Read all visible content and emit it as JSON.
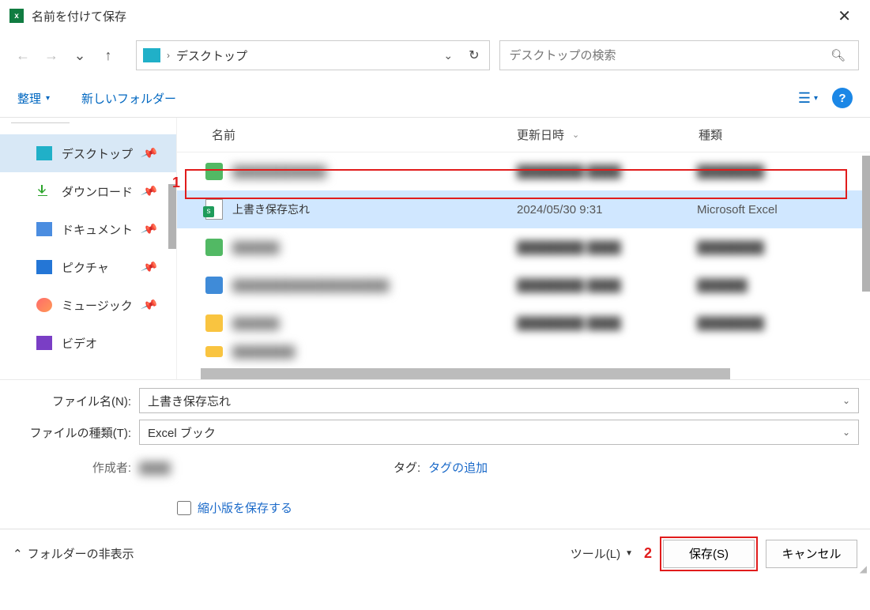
{
  "title": "名前を付けて保存",
  "path": {
    "crumb": "デスクトップ"
  },
  "search": {
    "placeholder": "デスクトップの検索"
  },
  "toolbar": {
    "organize": "整理",
    "newfolder": "新しいフォルダー"
  },
  "sidebar": {
    "items": [
      {
        "label": "デスクトップ"
      },
      {
        "label": "ダウンロード"
      },
      {
        "label": "ドキュメント"
      },
      {
        "label": "ピクチャ"
      },
      {
        "label": "ミュージック"
      },
      {
        "label": "ビデオ"
      }
    ]
  },
  "columns": {
    "name": "名前",
    "date": "更新日時",
    "type": "種類"
  },
  "files": {
    "selected": {
      "name": "上書き保存忘れ",
      "date": "2024/05/30 9:31",
      "type": "Microsoft Excel"
    },
    "blur1": {
      "name": "████████████",
      "date": "████████ ████"
    },
    "blur2": {
      "name": "██████",
      "date": "████████ ████"
    },
    "blur3": {
      "name": "████████████████████",
      "date": "████████ ████"
    },
    "blur4": {
      "name": "██████",
      "date": "████████ ████"
    },
    "blur5": {
      "name": "████████"
    }
  },
  "form": {
    "filename_lbl": "ファイル名(N):",
    "filename_val": "上書き保存忘れ",
    "filetype_lbl": "ファイルの種類(T):",
    "filetype_val": "Excel ブック",
    "author_lbl": "作成者:",
    "tag_lbl": "タグ:",
    "tag_link": "タグの追加",
    "thumb": "縮小版を保存する"
  },
  "footer": {
    "hide": "フォルダーの非表示",
    "tools": "ツール(L)",
    "save": "保存(S)",
    "cancel": "キャンセル"
  },
  "markers": {
    "m1": "1",
    "m2": "2"
  }
}
